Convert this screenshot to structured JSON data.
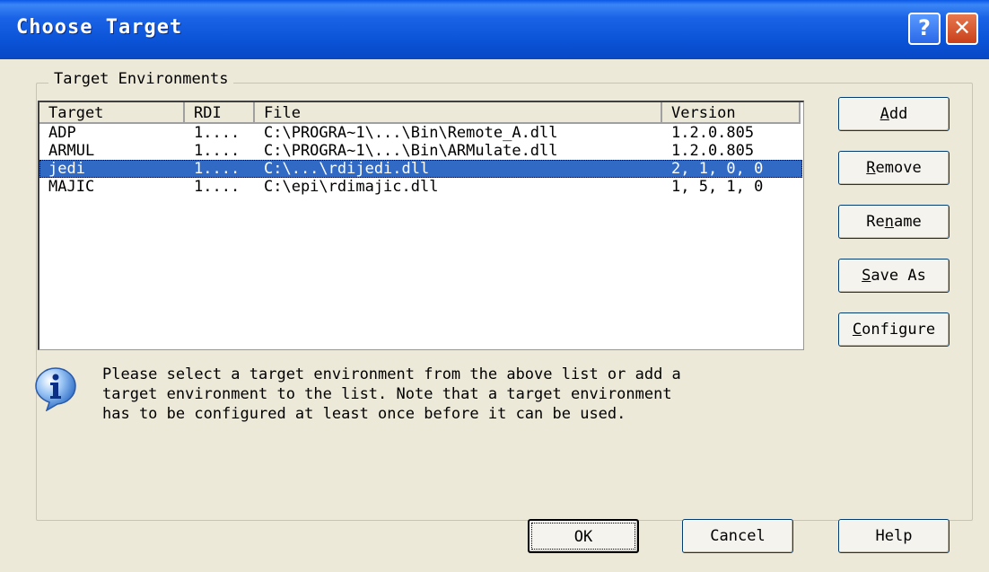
{
  "window": {
    "title": "Choose Target",
    "help_glyph": "?",
    "close_glyph": "✕"
  },
  "group": {
    "label": "Target Environments"
  },
  "list": {
    "columns": [
      "Target",
      "RDI",
      "File",
      "Version"
    ],
    "rows": [
      {
        "target": "ADP",
        "rdi": "1....",
        "file": "C:\\PROGRA~1\\...\\Bin\\Remote_A.dll",
        "version": "1.2.0.805",
        "selected": false
      },
      {
        "target": "ARMUL",
        "rdi": "1....",
        "file": "C:\\PROGRA~1\\...\\Bin\\ARMulate.dll",
        "version": "1.2.0.805",
        "selected": false
      },
      {
        "target": "jedi",
        "rdi": "1....",
        "file": "C:\\...\\rdijedi.dll",
        "version": "2, 1, 0, 0",
        "selected": true
      },
      {
        "target": "MAJIC",
        "rdi": "1....",
        "file": "C:\\epi\\rdimajic.dll",
        "version": "1, 5, 1, 0",
        "selected": false
      }
    ]
  },
  "side_buttons": [
    {
      "id": "add",
      "label": "Add",
      "mnemonic_index": 0
    },
    {
      "id": "remove",
      "label": "Remove",
      "mnemonic_index": 0
    },
    {
      "id": "rename",
      "label": "Rename",
      "mnemonic_index": 2
    },
    {
      "id": "save-as",
      "label": "Save As",
      "mnemonic_index": 0
    },
    {
      "id": "configure",
      "label": "Configure",
      "mnemonic_index": 0
    }
  ],
  "info": {
    "icon": "info-icon",
    "lines": [
      "Please select a target environment from the above list or add a",
      "target environment to the list. Note that a target environment",
      "has to be configured at least once before it can be used."
    ]
  },
  "bottom_buttons": {
    "ok": "OK",
    "cancel": "Cancel",
    "help": "Help"
  },
  "colors": {
    "titlebar": "#0a52d6",
    "selection": "#316ac5",
    "face": "#ece9d8"
  }
}
